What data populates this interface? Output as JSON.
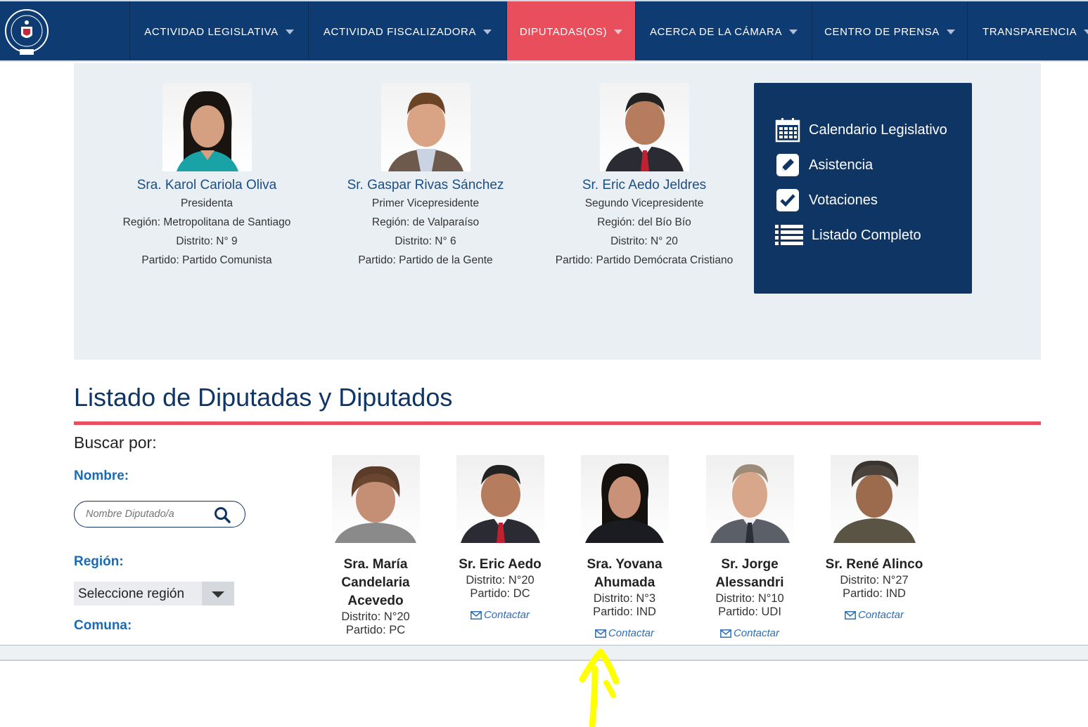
{
  "nav": {
    "items": [
      {
        "label": "ACTIVIDAD LEGISLATIVA"
      },
      {
        "label": "ACTIVIDAD FISCALIZADORA"
      },
      {
        "label": "DIPUTADAS(OS)"
      },
      {
        "label": "ACERCA DE LA CÁMARA"
      },
      {
        "label": "CENTRO DE PRENSA"
      },
      {
        "label": "TRANSPARENCIA"
      }
    ]
  },
  "featured": [
    {
      "name": "Sra. Karol Cariola Oliva",
      "role": "Presidenta",
      "region": "Región: Metropolitana de Santiago",
      "district": "Distrito: N° 9",
      "party": "Partido: Partido Comunista"
    },
    {
      "name": "Sr. Gaspar Rivas Sánchez",
      "role": "Primer Vicepresidente",
      "region": "Región: de Valparaíso",
      "district": "Distrito: N° 6",
      "party": "Partido: Partido de la Gente"
    },
    {
      "name": "Sr. Eric Aedo Jeldres",
      "role": "Segundo Vicepresidente",
      "region": "Región: del Bío Bío",
      "district": "Distrito: N° 20",
      "party": "Partido: Partido Demócrata Cristiano"
    }
  ],
  "quicklinks": [
    {
      "label": "Calendario Legislativo",
      "icon": "calendar-icon"
    },
    {
      "label": "Asistencia",
      "icon": "pencil-icon"
    },
    {
      "label": "Votaciones",
      "icon": "checkbox-icon"
    },
    {
      "label": "Listado Completo",
      "icon": "list-icon"
    }
  ],
  "list": {
    "title": "Listado de Diputadas y Diputados",
    "search_by": "Buscar por:",
    "name_label": "Nombre:",
    "name_placeholder": "Nombre Diputado/a",
    "region_label": "Región:",
    "region_value": "Seleccione región",
    "commune_label": "Comuna:"
  },
  "deputies": [
    {
      "name_lines": [
        "Sra. María",
        "Candelaria",
        "Acevedo"
      ],
      "district": "Distrito: N°20",
      "party": "Partido: PC"
    },
    {
      "name_lines": [
        "Sr. Eric Aedo"
      ],
      "district": "Distrito: N°20",
      "party": "Partido: DC",
      "contact": "Contactar"
    },
    {
      "name_lines": [
        "Sra. Yovana",
        "Ahumada"
      ],
      "district": "Distrito: N°3",
      "party": "Partido: IND",
      "contact": "Contactar"
    },
    {
      "name_lines": [
        "Sr. Jorge",
        "Alessandri"
      ],
      "district": "Distrito: N°10",
      "party": "Partido: UDI",
      "contact": "Contactar"
    },
    {
      "name_lines": [
        "Sr. René Alinco"
      ],
      "district": "Distrito: N°27",
      "party": "Partido: IND",
      "contact": "Contactar"
    }
  ],
  "colors": {
    "nav_bg": "#0f3b73",
    "active": "#e84e5c",
    "panel_bg": "#eaeff3",
    "quicklinks_bg": "#0f3564",
    "annotation_arrow": "#ffff00"
  }
}
